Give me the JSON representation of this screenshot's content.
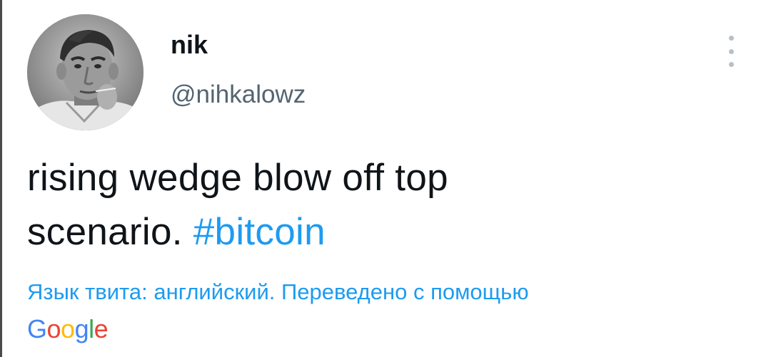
{
  "author": {
    "display_name": "nik",
    "handle": "@nihkalowz"
  },
  "tweet": {
    "text_before": "rising wedge blow off top",
    "text_line2": "scenario. ",
    "hashtag": "#bitcoin"
  },
  "translation": {
    "label": "Язык твита: английский. Переведено с помощью",
    "provider_letters": [
      "G",
      "o",
      "o",
      "g",
      "l",
      "e"
    ]
  },
  "icons": {
    "more": "more-vertical-icon",
    "avatar": "avatar-image"
  },
  "colors": {
    "link": "#1d9bf0",
    "secondary_text": "#536471",
    "primary_text": "#0f1419",
    "google_blue": "#4285f4",
    "google_red": "#ea4335",
    "google_yellow": "#fbbc05",
    "google_green": "#34a853"
  }
}
